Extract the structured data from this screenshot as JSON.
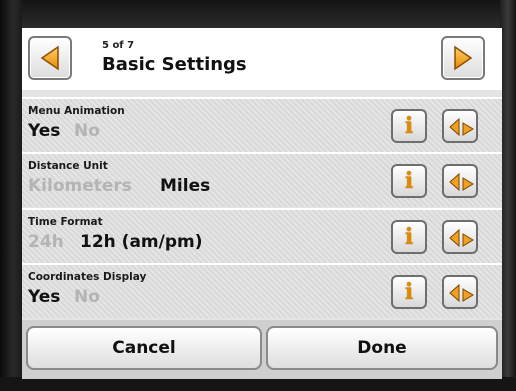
{
  "header": {
    "pager": "5 of 7",
    "title": "Basic Settings"
  },
  "settings": [
    {
      "label": "Menu Animation",
      "options": [
        "Yes",
        "No"
      ],
      "selected": "Yes"
    },
    {
      "label": "Distance Unit",
      "options": [
        "Kilometers",
        "Miles"
      ],
      "selected": "Miles"
    },
    {
      "label": "Time Format",
      "options": [
        "24h",
        "12h (am/pm)"
      ],
      "selected": "12h (am/pm)"
    },
    {
      "label": "Coordinates Display",
      "options": [
        "Yes",
        "No"
      ],
      "selected": "Yes"
    }
  ],
  "icons": {
    "prev": "left-arrow-icon",
    "next": "right-arrow-icon",
    "info": "info-icon",
    "toggle": "toggle-arrows-icon"
  },
  "info_glyph": "i",
  "footer": {
    "cancel_label": "Cancel",
    "done_label": "Done"
  },
  "colors": {
    "accent": "#f0a020",
    "selected_text": "#111111",
    "unselected_text": "#b4b4b4"
  }
}
